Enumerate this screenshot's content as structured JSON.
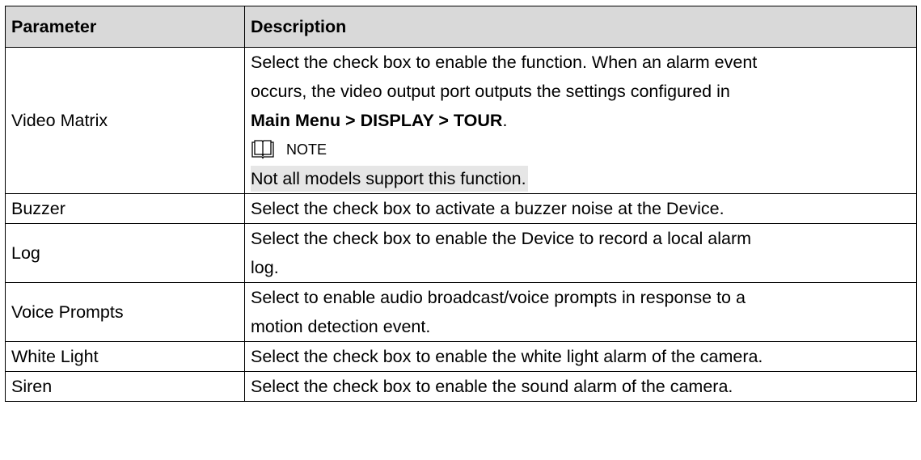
{
  "header": {
    "param": "Parameter",
    "desc": "Description"
  },
  "video_matrix": {
    "param": "Video Matrix",
    "line1": "Select the check box to enable the function. When an alarm event",
    "line2": "occurs, the video output port outputs the settings configured in",
    "path": "Main Menu > DISPLAY > TOUR",
    "period": ".",
    "note_label": "NOTE",
    "note_text": "Not all models support this function."
  },
  "rows": [
    {
      "param": "Buzzer",
      "desc": "Select the check box to activate a buzzer noise at the Device."
    },
    {
      "param": "Log",
      "desc1": "Select the check box to enable the Device to record a local alarm",
      "desc2": "log."
    },
    {
      "param": "Voice Prompts",
      "desc1": "Select to enable audio broadcast/voice prompts in response to a",
      "desc2": "motion detection event."
    },
    {
      "param": "White Light",
      "desc": "Select the check box to enable the white light alarm of the camera."
    },
    {
      "param": "Siren",
      "desc": "Select the check box to enable the sound alarm of the camera."
    }
  ]
}
